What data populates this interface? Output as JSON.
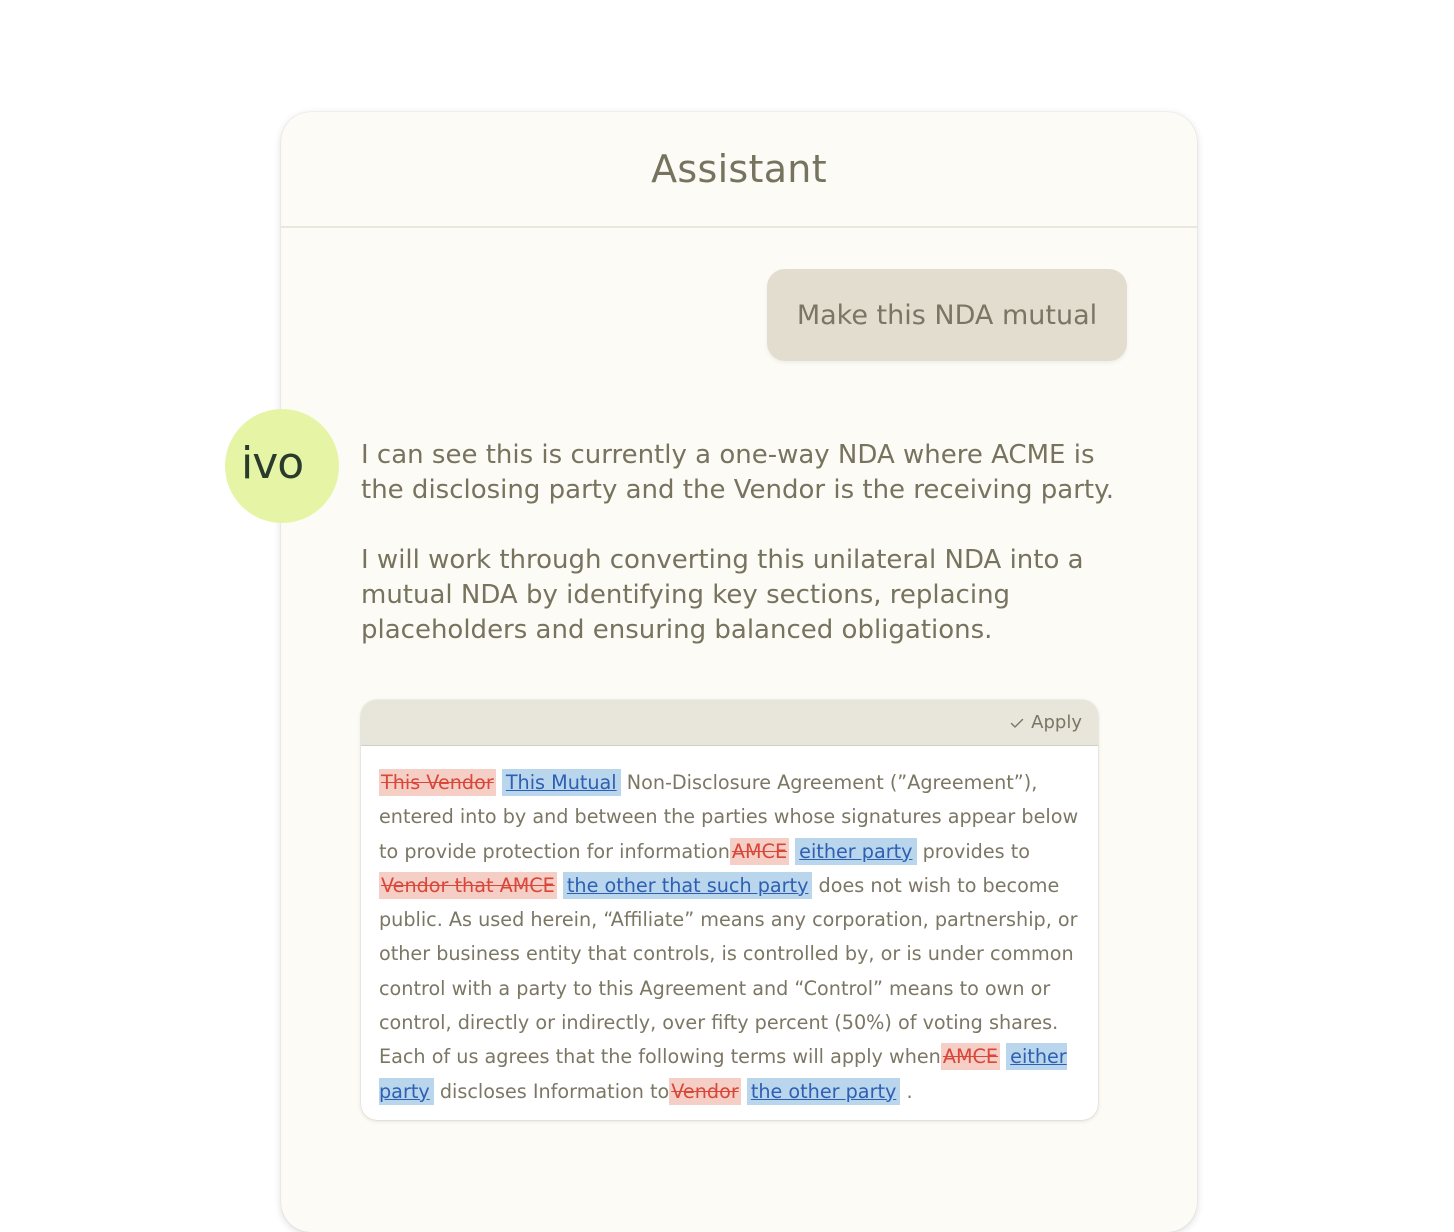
{
  "panel": {
    "title": "Assistant"
  },
  "user_message": "Make this NDA mutual",
  "avatar": {
    "logo_text": "ivo"
  },
  "assistant": {
    "paragraph_1": "I can see this is currently a one-way NDA where ACME is the disclosing party and the Vendor is the receiving party.",
    "paragraph_2": "I will work through converting this unilateral NDA into a mutual NDA by identifying key sections, replacing placeholders and ensuring balanced obligations."
  },
  "suggestion_card": {
    "apply_label": "Apply",
    "apply_icon": "check-icon",
    "segments": [
      {
        "type": "del",
        "text": "This Vendor"
      },
      {
        "type": "ins",
        "text": "This Mutual"
      },
      {
        "type": "text",
        "text": " Non-Disclosure Agreement (”Agreement”), entered into by and between the parties whose signatures appear below to provide protection for information"
      },
      {
        "type": "del",
        "text": "AMCE"
      },
      {
        "type": "ins",
        "text": "either party"
      },
      {
        "type": "text",
        "text": " provides to "
      },
      {
        "type": "del",
        "text": "Vendor that AMCE"
      },
      {
        "type": "ins",
        "text": "the other that such party"
      },
      {
        "type": "text",
        "text": " does not wish to become public. As used herein, “Affiliate” means any corporation, partnership, or other business entity that controls, is controlled by, or is under common control with a party to this Agreement and “Control” means to own or control, directly or indirectly, over fifty percent (50%) of voting shares. Each of us agrees that the following terms will apply when"
      },
      {
        "type": "del",
        "text": "AMCE"
      },
      {
        "type": "ins",
        "text": "either party"
      },
      {
        "type": "text",
        "text": " discloses Information to"
      },
      {
        "type": "del",
        "text": "Vendor"
      },
      {
        "type": "ins",
        "text": "the other party"
      },
      {
        "type": "text",
        "text": "."
      }
    ]
  },
  "colors": {
    "panel_background": "#fdfbf5",
    "avatar_background": "#e5f5a5",
    "user_bubble": "#e3ddd0",
    "deletion_highlight": "#f5cfc6",
    "deletion_text": "#d9473a",
    "insertion_highlight": "#b9d6ec",
    "insertion_text": "#2e5fb2"
  }
}
